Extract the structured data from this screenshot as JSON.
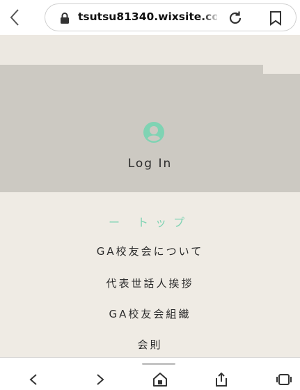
{
  "browser": {
    "url": "tsutsu81340.wixsite.com",
    "icons": {
      "back": "chevron-left-icon",
      "lock": "lock-icon",
      "reload": "reload-icon",
      "bookmark": "bookmark-icon"
    }
  },
  "site": {
    "login": {
      "label": "Log In",
      "icon": "user-icon",
      "accent": "#7fd3b3"
    },
    "menu": [
      {
        "label": "ー トップ",
        "active": true
      },
      {
        "label": "GA校友会について",
        "active": false
      },
      {
        "label": "代表世話人挨拶",
        "active": false
      },
      {
        "label": "GA校友会組織",
        "active": false
      },
      {
        "label": "会則",
        "active": false
      }
    ],
    "colors": {
      "background": "#efebe4",
      "panel": "#ccc9c2",
      "active": "#7fd3b3"
    }
  },
  "bottom_nav": {
    "icons": [
      "back-icon",
      "forward-icon",
      "home-icon",
      "share-icon",
      "tabs-icon"
    ]
  }
}
